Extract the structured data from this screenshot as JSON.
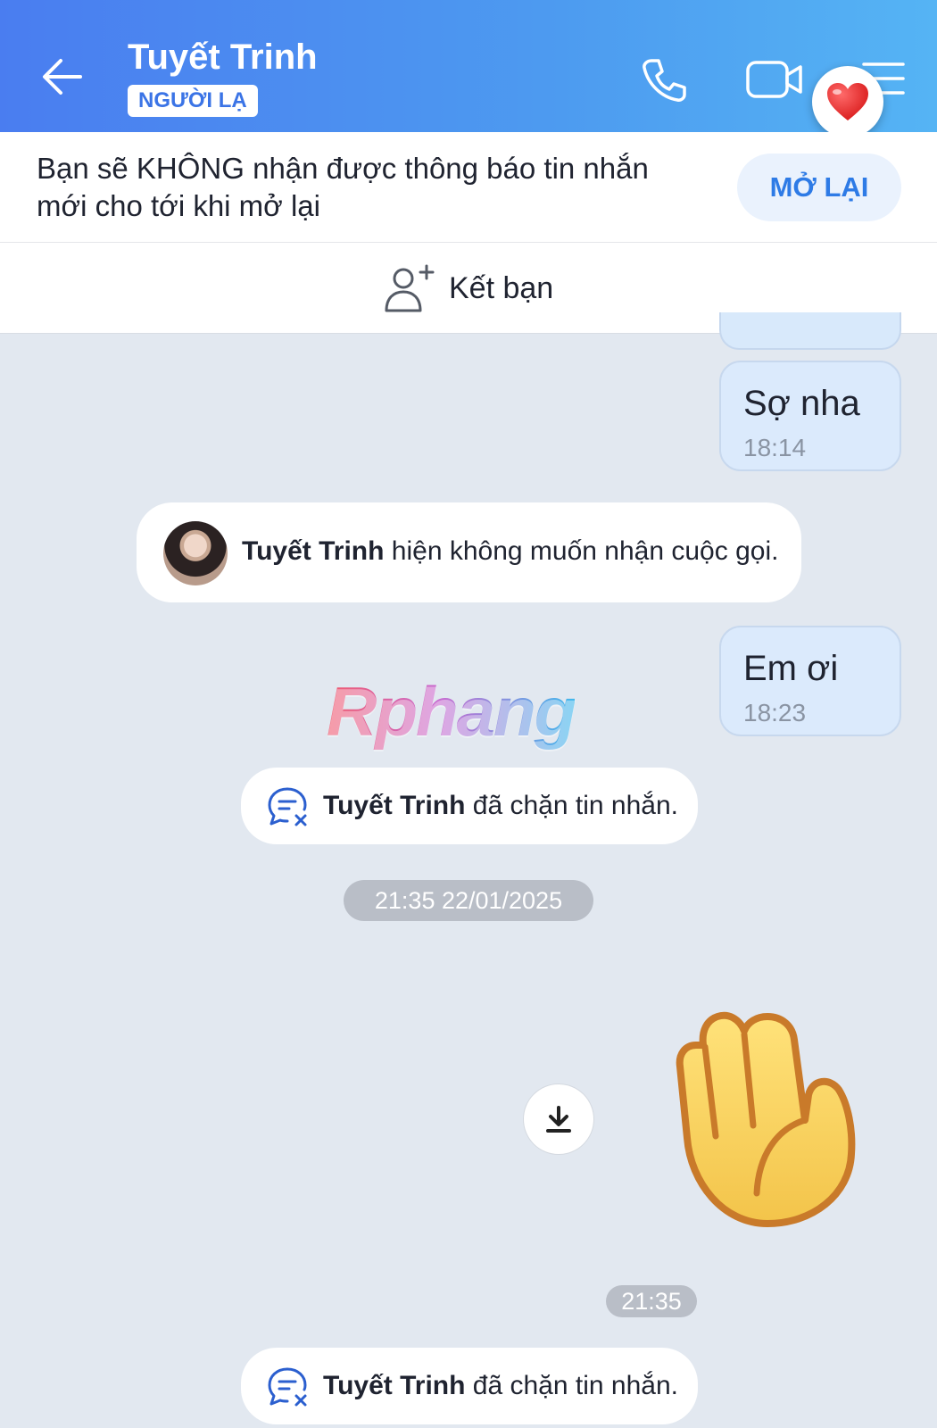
{
  "header": {
    "title": "Tuyết Trinh",
    "badge": "NGƯỜI LẠ",
    "accent_color": "#4a7df0",
    "icons": [
      "back-arrow-icon",
      "phone-icon",
      "video-camera-icon",
      "menu-icon",
      "heart-icon"
    ]
  },
  "notice": {
    "text": "Bạn sẽ KHÔNG nhận được thông báo tin nhắn mới cho tới khi mở lại",
    "reopen_label": "MỞ LẠI"
  },
  "add_friend": {
    "label": "Kết bạn",
    "icon": "add-friend-icon"
  },
  "messages": [
    {
      "type": "outgoing",
      "text": "Sợ nha",
      "time": "18:14"
    },
    {
      "type": "system",
      "name": "Tuyết Trinh",
      "text": "hiện không muốn nhận cuộc gọi."
    },
    {
      "type": "outgoing",
      "text": "Em ơi",
      "time": "18:23"
    },
    {
      "type": "system",
      "name": "Tuyết Trinh",
      "text": "đã chặn tin nhắn."
    },
    {
      "type": "date",
      "text": "21:35 22/01/2025"
    },
    {
      "type": "sticker",
      "icon": "raised-hand-icon",
      "time": "21:35"
    },
    {
      "type": "system",
      "name": "Tuyết Trinh",
      "text": "đã chặn tin nhắn."
    }
  ],
  "watermark": "Rphang"
}
